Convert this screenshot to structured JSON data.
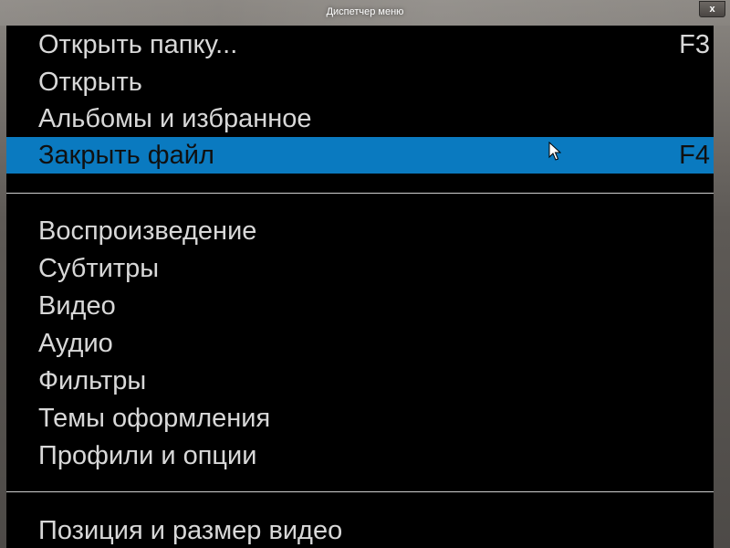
{
  "window": {
    "title": "Диспетчер меню",
    "close_label": "x"
  },
  "menu": {
    "group1": [
      {
        "label": "Открыть папку...",
        "shortcut": "F3"
      },
      {
        "label": "Открыть",
        "shortcut": ""
      },
      {
        "label": "Альбомы и избранное",
        "shortcut": ""
      },
      {
        "label": "Закрыть файл",
        "shortcut": "F4",
        "highlighted": true
      }
    ],
    "group2": [
      {
        "label": "Воспроизведение"
      },
      {
        "label": "Субтитры"
      },
      {
        "label": "Видео"
      },
      {
        "label": "Аудио"
      },
      {
        "label": "Фильтры"
      },
      {
        "label": "Темы оформления"
      },
      {
        "label": "Профили и опции"
      }
    ],
    "group3": [
      {
        "label": "Позиция и размер видео"
      }
    ]
  },
  "colors": {
    "highlight": "#0a7ac0",
    "background": "#000000",
    "text": "#d8d8d8"
  },
  "icons": {
    "cursor": "mouse-pointer-icon",
    "close": "close-icon"
  }
}
